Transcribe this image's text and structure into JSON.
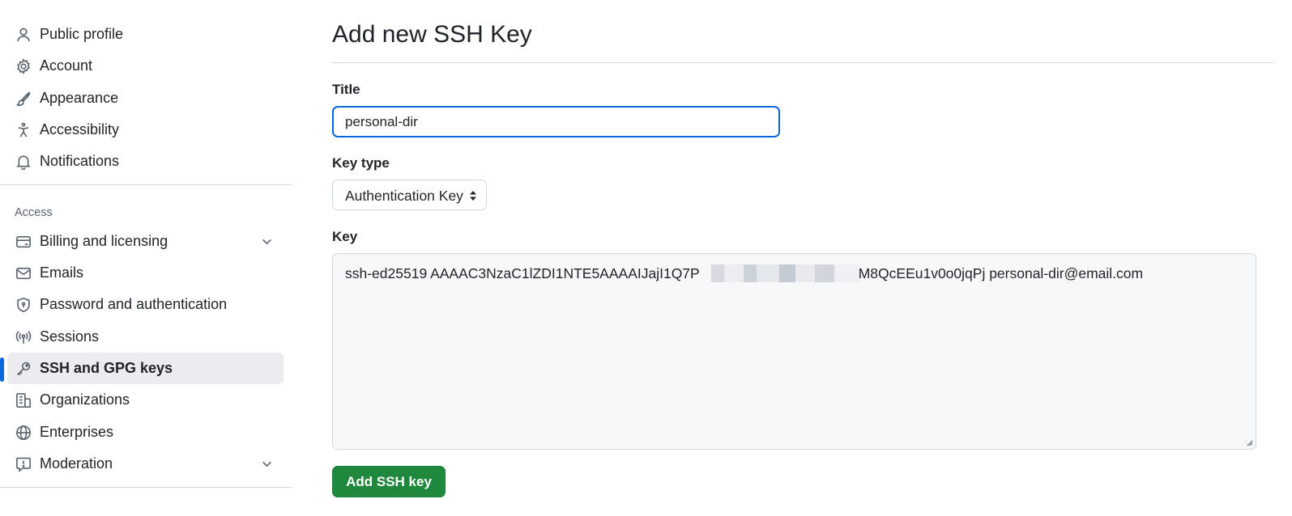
{
  "sidebar": {
    "top_items": [
      {
        "label": "Public profile",
        "icon": "person-icon"
      },
      {
        "label": "Account",
        "icon": "gear-icon"
      },
      {
        "label": "Appearance",
        "icon": "paintbrush-icon"
      },
      {
        "label": "Accessibility",
        "icon": "accessibility-icon"
      },
      {
        "label": "Notifications",
        "icon": "bell-icon"
      }
    ],
    "section_label": "Access",
    "access_items": [
      {
        "label": "Billing and licensing",
        "icon": "credit-card-icon",
        "expandable": true
      },
      {
        "label": "Emails",
        "icon": "mail-icon"
      },
      {
        "label": "Password and authentication",
        "icon": "shield-icon"
      },
      {
        "label": "Sessions",
        "icon": "broadcast-icon"
      },
      {
        "label": "SSH and GPG keys",
        "icon": "key-icon",
        "active": true
      },
      {
        "label": "Organizations",
        "icon": "organization-icon"
      },
      {
        "label": "Enterprises",
        "icon": "globe-icon"
      },
      {
        "label": "Moderation",
        "icon": "report-icon",
        "expandable": true
      }
    ]
  },
  "main": {
    "title": "Add new SSH Key",
    "title_field": {
      "label": "Title",
      "value": "personal-dir"
    },
    "key_type": {
      "label": "Key type",
      "selected": "Authentication Key"
    },
    "key_field": {
      "label": "Key",
      "value_start": "ssh-ed25519 AAAAC3NzaC1lZDI1NTE5AAAAIJajI1Q7P",
      "value_end": "M8QcEEu1v0o0jqPj personal-dir@email.com"
    },
    "submit_label": "Add SSH key"
  },
  "colors": {
    "accent": "#0969da",
    "active_bg": "#eaecef",
    "primary_button": "#1f883d",
    "border": "#d1d9e0",
    "muted_text": "#59636e"
  }
}
